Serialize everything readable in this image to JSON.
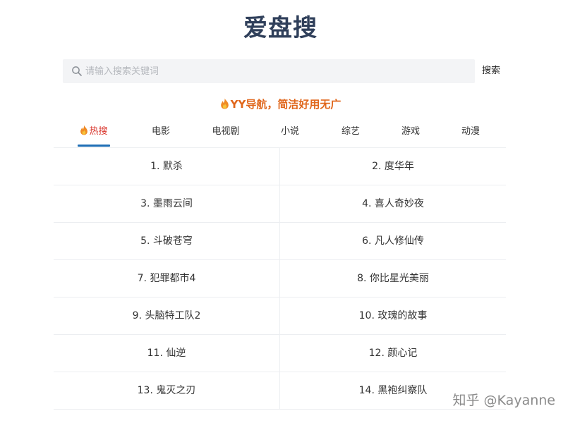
{
  "header": {
    "title": "爱盘搜"
  },
  "search": {
    "placeholder": "请输入搜索关键词",
    "value": "",
    "button_label": "搜索"
  },
  "promo": {
    "text": "YY导航，简洁好用无广"
  },
  "tabs": [
    {
      "label": "热搜",
      "active": true
    },
    {
      "label": "电影",
      "active": false
    },
    {
      "label": "电视剧",
      "active": false
    },
    {
      "label": "小说",
      "active": false
    },
    {
      "label": "综艺",
      "active": false
    },
    {
      "label": "游戏",
      "active": false
    },
    {
      "label": "动漫",
      "active": false
    }
  ],
  "hot_list": [
    "1. 默杀",
    "2. 度华年",
    "3. 墨雨云间",
    "4. 喜人奇妙夜",
    "5. 斗破苍穹",
    "6. 凡人修仙传",
    "7. 犯罪都市4",
    "8. 你比星光美丽",
    "9. 头脑特工队2",
    "10. 玫瑰的故事",
    "11. 仙逆",
    "12. 颜心记",
    "13. 鬼灭之刃",
    "14. 黑袍纠察队"
  ],
  "watermark": {
    "text": "知乎 @Kayanne"
  },
  "colors": {
    "title": "#2f3f5a",
    "promo": "#e0661b",
    "active_tab_text": "#d9342b",
    "active_tab_underline": "#1f6fb5",
    "search_bg": "#f3f4f6"
  },
  "icons": {
    "search": "search-icon",
    "promo": "flame-icon",
    "hot_tab": "flame-icon"
  }
}
